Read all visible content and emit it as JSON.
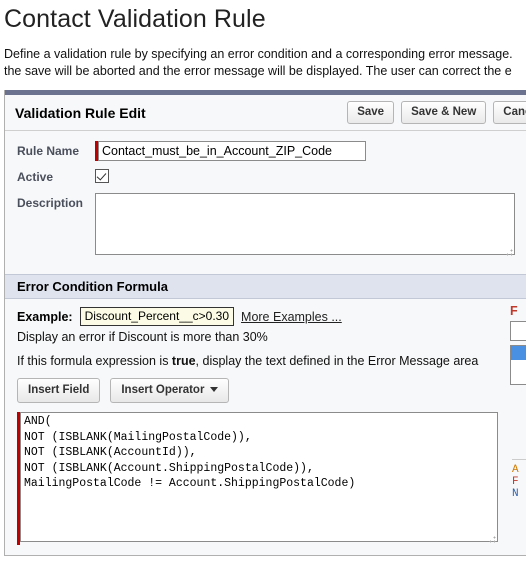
{
  "page": {
    "title": "Contact Validation Rule",
    "intro_line1": "Define a validation rule by specifying an error condition and a corresponding error message.",
    "intro_line2": "the save will be aborted and the error message will be displayed. The user can correct the e"
  },
  "panel": {
    "header_title": "Validation Rule Edit",
    "buttons": [
      {
        "label": "Save",
        "name": "save-button"
      },
      {
        "label": "Save & New",
        "name": "save-and-new-button"
      },
      {
        "label": "Cancel",
        "name": "cancel-button"
      }
    ]
  },
  "form": {
    "rule_name_label": "Rule Name",
    "rule_name_value": "Contact_must_be_in_Account_ZIP_Code",
    "active_label": "Active",
    "active_checked": true,
    "description_label": "Description",
    "description_value": "",
    "description_placeholder": ""
  },
  "formula_section": {
    "header": "Error Condition Formula",
    "example_label": "Example:",
    "example_value": "Discount_Percent__c>0.30",
    "more_examples_link": "More Examples ...",
    "example_description": "Display an error if Discount is more than 30%",
    "note_prefix": "If this formula expression is ",
    "note_bold": "true",
    "note_suffix": ", display the text defined in the Error Message area",
    "insert_field_button": "Insert Field",
    "insert_operator_button": "Insert Operator",
    "formula_value": "AND(\nNOT (ISBLANK(MailingPostalCode)),\nNOT (ISBLANK(AccountId)),\nNOT (ISBLANK(Account.ShippingPostalCode)),\nMailingPostalCode != Account.ShippingPostalCode)"
  },
  "side_panel": {
    "label": "F",
    "row_a": "A",
    "row_b": "F",
    "row_c": "N"
  },
  "colors": {
    "panel_topbar": "#6b7290",
    "section_header_bg": "#dfe3ee",
    "required_marker": "#c00000",
    "example_box_bg": "#fbfbe6",
    "selection_blue": "#4a90e2",
    "page_bg": "#f7f8f9"
  }
}
